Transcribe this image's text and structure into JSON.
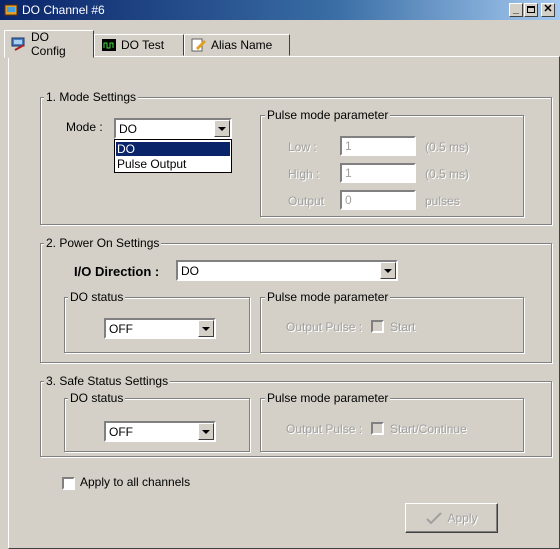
{
  "window": {
    "title": "DO Channel #6",
    "min_icon": "minimize-icon",
    "max_icon": "maximize-icon",
    "close_icon": "close-icon"
  },
  "tabs": [
    {
      "label": "DO Config",
      "icon": "config-icon"
    },
    {
      "label": "DO Test",
      "icon": "test-icon"
    },
    {
      "label": "Alias Name",
      "icon": "pencil-icon"
    }
  ],
  "mode_settings": {
    "group_label": "1. Mode Settings",
    "mode_label": "Mode :",
    "mode_value": "DO",
    "dropdown_options": [
      "DO",
      "Pulse Output"
    ],
    "pulse_group_label": "Pulse mode parameter",
    "low_label": "Low :",
    "low_value": "1",
    "low_unit": "(0.5 ms)",
    "high_label": "High :",
    "high_value": "1",
    "high_unit": "(0.5 ms)",
    "output_label": "Output",
    "output_value": "0",
    "output_unit": "pulses"
  },
  "power_on_settings": {
    "group_label": "2. Power On Settings",
    "io_direction_label": "I/O Direction :",
    "io_direction_value": "DO",
    "do_status_label": "DO status",
    "do_status_value": "OFF",
    "pulse_group_label": "Pulse mode parameter",
    "output_pulse_label": "Output Pulse :",
    "start_label": "Start"
  },
  "safe_status_settings": {
    "group_label": "3. Safe Status Settings",
    "do_status_label": "DO status",
    "do_status_value": "OFF",
    "pulse_group_label": "Pulse mode parameter",
    "output_pulse_label": "Output Pulse :",
    "start_label": "Start/Continue"
  },
  "apply_all_label": "Apply to all channels",
  "apply_button_label": "Apply",
  "colors": {
    "face": "#d4d0c8",
    "title_start": "#0a246a",
    "title_end": "#a6caf0",
    "selection": "#0a246a"
  }
}
